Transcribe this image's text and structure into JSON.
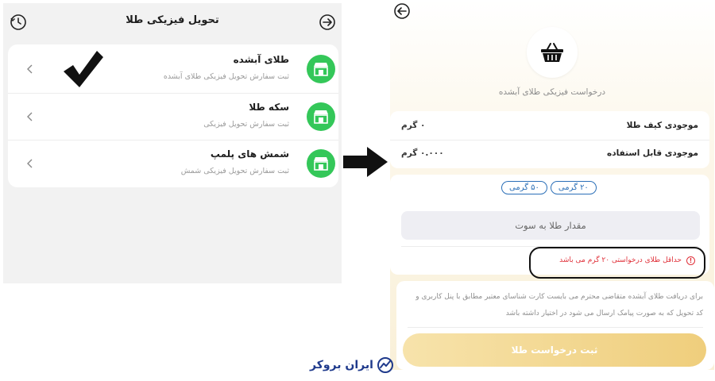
{
  "left_screen": {
    "title": "تحویل فیزیکی طلا",
    "items": [
      {
        "title": "طلای آبشده",
        "subtitle": "ثبت سفارش تحویل فیزیکی طلای آبشده",
        "icon": "store-icon"
      },
      {
        "title": "سکه طلا",
        "subtitle": "ثبت سفارش تحویل فیزیکی",
        "icon": "store-icon"
      },
      {
        "title": "شمش های پلمپ",
        "subtitle": "ثبت سفارش تحویل فیزیکی شمش",
        "icon": "store-icon"
      }
    ],
    "accent": "#34c759"
  },
  "right_screen": {
    "subtitle": "درخواست فیزیکی طلای آبشده",
    "balance": {
      "wallet_label": "موجودی کیف طلا",
      "wallet_value": "۰ گرم",
      "usable_label": "موجودی قابل استفاده",
      "usable_value": "۰.۰۰۰ گرم"
    },
    "chips": [
      "۲۰ گرمی",
      "۵۰ گرمی"
    ],
    "amount_placeholder": "مقدار طلا به سوت",
    "warning": "حداقل طلای درخواستی ۲۰ گرم می باشد",
    "info": "برای دریافت طلای آبشده متقاضی محترم می بایست کارت شناسای معتبر مطابق با پنل کاربری و کد تحویل که به صورت پیامک ارسال می شود در اختیار داشته باشد",
    "submit_label": "ثبت درخواست طلا",
    "warning_color": "#e0313a",
    "chip_color": "#2b6fb7"
  },
  "watermark": "ایران بروکر"
}
